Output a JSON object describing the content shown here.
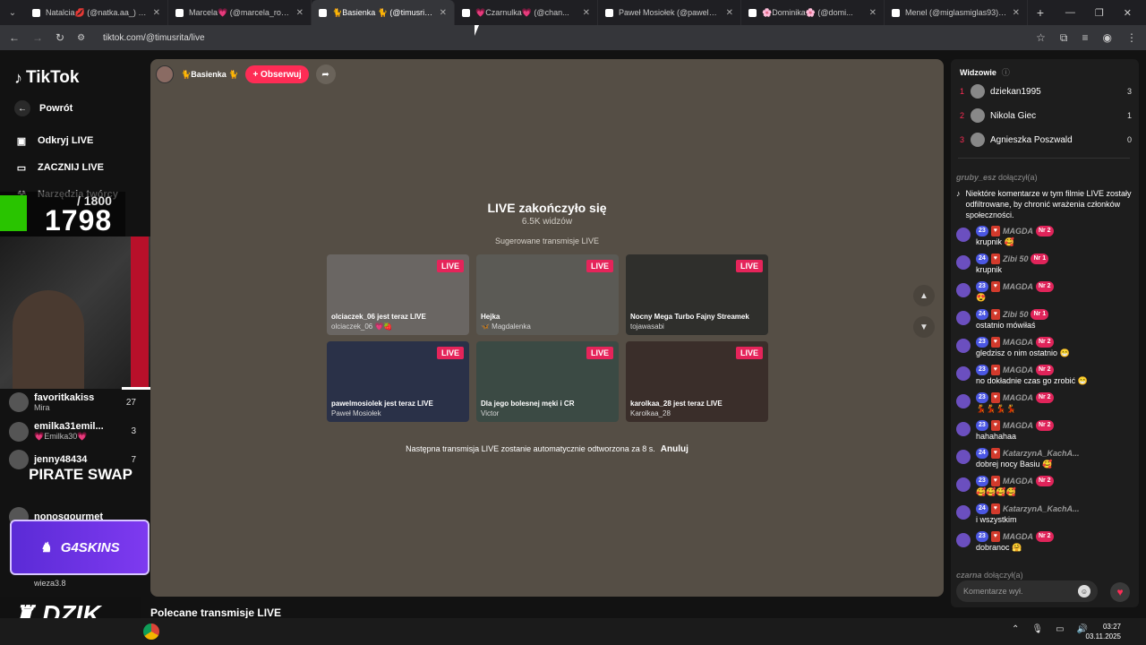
{
  "browser": {
    "tabs": [
      {
        "label": "Natalcia💋 (@natka.aa_) prowa...",
        "active": false
      },
      {
        "label": "Marcela💗 (@marcela_rozum) ...",
        "active": false
      },
      {
        "label": "🐈Basienka 🐈 (@timusrita) ...",
        "active": true
      },
      {
        "label": "💗Czarnulka💗 (@chan...",
        "active": false
      },
      {
        "label": "Paweł Mosiołek (@pawelmosio...",
        "active": false
      },
      {
        "label": "🌸Dominika🌸 (@domi...",
        "active": false
      },
      {
        "label": "Menel (@miglasmiglas93) prow...",
        "active": false
      }
    ],
    "url": "tiktok.com/@timusrita/live"
  },
  "sidebar": {
    "logo": "TikTok",
    "back": "Powrót",
    "items": [
      {
        "label": "Odkryj LIVE",
        "icon": "live-tv-icon"
      },
      {
        "label": "ZACZNIJ LIVE",
        "icon": "camera-icon"
      },
      {
        "label": "Narzędzia twórcy",
        "icon": "tools-icon"
      }
    ],
    "overlay": {
      "goal": "/ 1800",
      "count": "1798"
    },
    "accounts": [
      {
        "name": "favoritkakiss",
        "sub": "Mira",
        "count": "27"
      },
      {
        "name": "emilka31emil...",
        "sub": "💗Emilka30💗",
        "count": "3"
      },
      {
        "name": "jenny48434",
        "sub": "",
        "count": "7"
      },
      {
        "name": "nonosgourmet",
        "sub": "",
        "count": ""
      }
    ],
    "wieza": "wieza3.8",
    "sponsors": {
      "pirate": "PIRATE SWAP",
      "g4": "G4SKINS",
      "dzik": "DZIK."
    }
  },
  "stream": {
    "host": "🐈Basienka 🐈",
    "follow": "+ Obserwuj",
    "ended_title": "LIVE zakończyło się",
    "ended_viewers": "6.5K widzów",
    "suggested_heading": "Sugerowane transmisje LIVE",
    "live_tag": "LIVE",
    "cards": [
      {
        "title": "olciaczek_06 jest teraz LIVE",
        "sub": "olciaczek_06 💗🍓",
        "bg": "#6a6663"
      },
      {
        "title": "Hejka",
        "sub": "🦋 Magdalenka",
        "bg": "#5b5a55"
      },
      {
        "title": "Nocny Mega Turbo Fajny Streamek",
        "sub": "tojawasabi",
        "bg": "#2f2f2c"
      },
      {
        "title": "pawelmosiolek jest teraz LIVE",
        "sub": "Paweł Mosiołek",
        "bg": "#2a3148"
      },
      {
        "title": "Dla jego bolesnej męki i CR",
        "sub": "Victor",
        "bg": "#3b4a44"
      },
      {
        "title": "karolkaa_28 jest teraz LIVE",
        "sub": "Karolkaa_28",
        "bg": "#3a2e2a"
      }
    ],
    "autoplay": "Następna transmisja LIVE zostanie automatycznie odtworzona za 8 s.",
    "cancel": "Anuluj"
  },
  "recommended": "Polecane transmisje LIVE",
  "viewers": {
    "title": "Widzowie",
    "list": [
      {
        "rank": "1",
        "name": "dziekan1995",
        "count": "3"
      },
      {
        "rank": "2",
        "name": "Nikola Giec",
        "count": "1"
      },
      {
        "rank": "3",
        "name": "Agnieszka Poszwald",
        "count": "0"
      }
    ]
  },
  "chat": {
    "join_top": {
      "user": "gruby_esz",
      "text": "dołączył(a)"
    },
    "filter_note": "Niektóre komentarze w tym filmie LIVE zostały odfiltrowane, by chronić wrażenia członków społeczności.",
    "messages": [
      {
        "lvl": "23",
        "user": "MAGDA",
        "fan": "Nr 2",
        "text": "krupnik 🥰"
      },
      {
        "lvl": "24",
        "user": "Zibi 50",
        "fan": "Nr 1",
        "text": "krupnik"
      },
      {
        "lvl": "23",
        "user": "MAGDA",
        "fan": "Nr 2",
        "text": "😍"
      },
      {
        "lvl": "24",
        "user": "Zibi 50",
        "fan": "Nr 1",
        "text": "ostatnio mówiłaś"
      },
      {
        "lvl": "23",
        "user": "MAGDA",
        "fan": "Nr 2",
        "text": "gledzisz o nim ostatnio 😁"
      },
      {
        "lvl": "23",
        "user": "MAGDA",
        "fan": "Nr 2",
        "text": "no dokładnie czas go zrobić 😁"
      },
      {
        "lvl": "23",
        "user": "MAGDA",
        "fan": "Nr 2",
        "text": "💃💃💃💃"
      },
      {
        "lvl": "23",
        "user": "MAGDA",
        "fan": "Nr 2",
        "text": "hahahahaa"
      },
      {
        "lvl": "24",
        "user": "KatarzynA_KachA...",
        "fan": "",
        "text": "dobrej nocy Basiu 🥰"
      },
      {
        "lvl": "23",
        "user": "MAGDA",
        "fan": "Nr 2",
        "text": "🥰🥰🥰🥰"
      },
      {
        "lvl": "24",
        "user": "KatarzynA_KachA...",
        "fan": "",
        "text": "i wszystkim"
      },
      {
        "lvl": "23",
        "user": "MAGDA",
        "fan": "Nr 2",
        "text": "dobranoc 🤗"
      }
    ],
    "join_bottom": {
      "user": "czarna",
      "text": "dołączył(a)"
    },
    "input_placeholder": "Komentarze wył."
  },
  "taskbar": {
    "time": "03:27",
    "date": "03.11.2025"
  }
}
